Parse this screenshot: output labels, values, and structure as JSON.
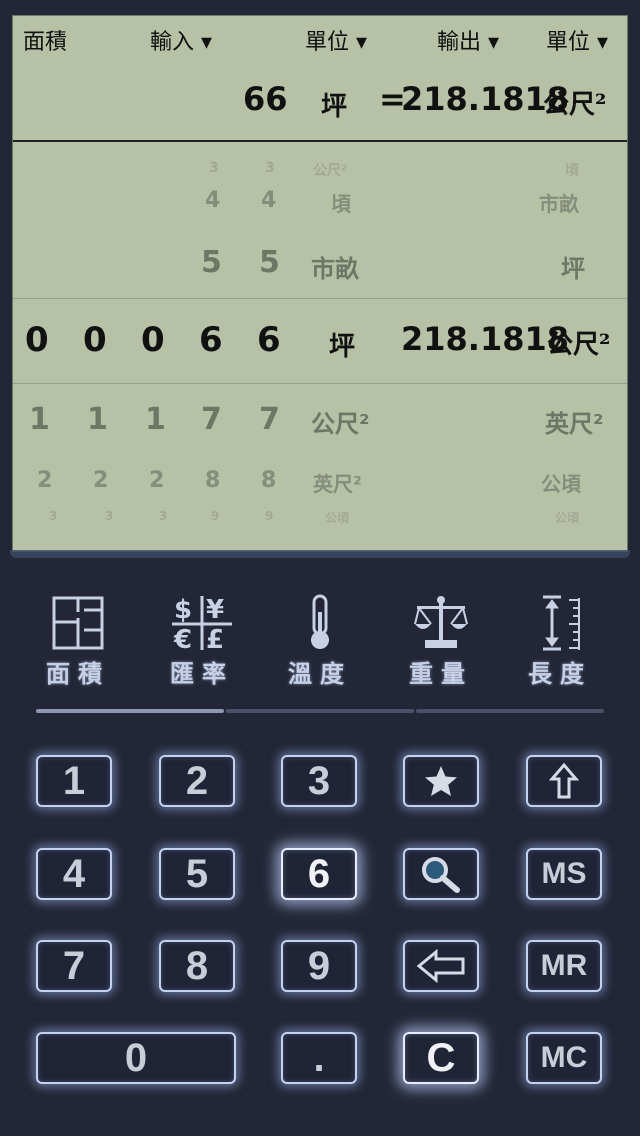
{
  "header": {
    "category": "面積",
    "input_unit_menu": "輸入 ▾",
    "input_unit_label": "單位 ▾",
    "output_menu": "輸出 ▾",
    "output_unit_label": "單位 ▾"
  },
  "result": {
    "input_value": "66",
    "input_unit": "坪",
    "equals": "=",
    "output_value": "218.1818",
    "output_unit": "公尺²"
  },
  "picker": {
    "rows": [
      {
        "digits": [
          "",
          "",
          "",
          "3",
          "3"
        ],
        "unit": "公尺²",
        "out_unit": "頃"
      },
      {
        "digits": [
          "",
          "",
          "",
          "4",
          "4"
        ],
        "unit": "頃",
        "out_unit": "市畝"
      },
      {
        "digits": [
          "",
          "",
          "",
          "5",
          "5"
        ],
        "unit": "市畝",
        "out_unit": "坪"
      },
      {
        "digits": [
          "0",
          "0",
          "0",
          "6",
          "6"
        ],
        "unit": "坪",
        "out_value": "218.1818",
        "out_unit": "公尺²"
      },
      {
        "digits": [
          "1",
          "1",
          "1",
          "7",
          "7"
        ],
        "unit": "公尺²",
        "out_unit": "英尺²"
      },
      {
        "digits": [
          "2",
          "2",
          "2",
          "8",
          "8"
        ],
        "unit": "英尺²",
        "out_unit": "公頃"
      },
      {
        "digits": [
          "3",
          "3",
          "3",
          "9",
          "9"
        ],
        "unit": "公頃",
        "out_unit": "公頃"
      }
    ]
  },
  "categories": [
    {
      "label": "面積",
      "icon": "floorplan-icon"
    },
    {
      "label": "匯率",
      "icon": "currency-icon"
    },
    {
      "label": "溫度",
      "icon": "thermometer-icon"
    },
    {
      "label": "重量",
      "icon": "scale-icon"
    },
    {
      "label": "長度",
      "icon": "ruler-icon"
    }
  ],
  "keys": {
    "k1": "1",
    "k2": "2",
    "k3": "3",
    "k4": "4",
    "k5": "5",
    "k6": "6",
    "k7": "7",
    "k8": "8",
    "k9": "9",
    "k0": "0",
    "dot": ".",
    "clear": "C",
    "ms": "MS",
    "mr": "MR",
    "mc": "MC"
  }
}
